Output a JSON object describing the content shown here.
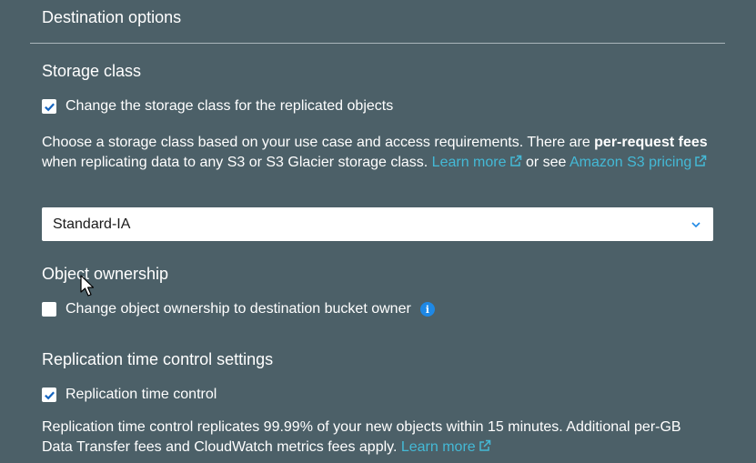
{
  "section": {
    "title": "Destination options"
  },
  "storage_class": {
    "heading": "Storage class",
    "checkbox_label": "Change the storage class for the replicated objects",
    "checked": true,
    "desc_part1": "Choose a storage class based on your use case and access requirements. There are ",
    "desc_bold": "per-request fees",
    "desc_part2": " when replicating data to any S3 or S3 Glacier storage class. ",
    "learn_more": "Learn more",
    "desc_part3": " or see ",
    "pricing_link": "Amazon S3 pricing",
    "selected_value": "Standard-IA"
  },
  "object_ownership": {
    "heading": "Object ownership",
    "checkbox_label": "Change object ownership to destination bucket owner",
    "checked": false,
    "info_glyph": "i"
  },
  "rtc": {
    "heading": "Replication time control settings",
    "checkbox_label": "Replication time control",
    "checked": true,
    "desc": "Replication time control replicates 99.99% of your new objects within 15 minutes. Additional per-GB Data Transfer fees and CloudWatch metrics fees apply. ",
    "learn_more": "Learn more"
  },
  "icons": {
    "checkbox_check": "checkmark-icon",
    "external_link": "external-link-icon",
    "dropdown": "chevron-down-icon",
    "info": "info-icon",
    "cursor": "mouse-pointer-icon"
  },
  "colors": {
    "background": "#4c6068",
    "link": "#44b9d6",
    "info": "#1e88e5",
    "checkbox_check": "#1565c0"
  }
}
